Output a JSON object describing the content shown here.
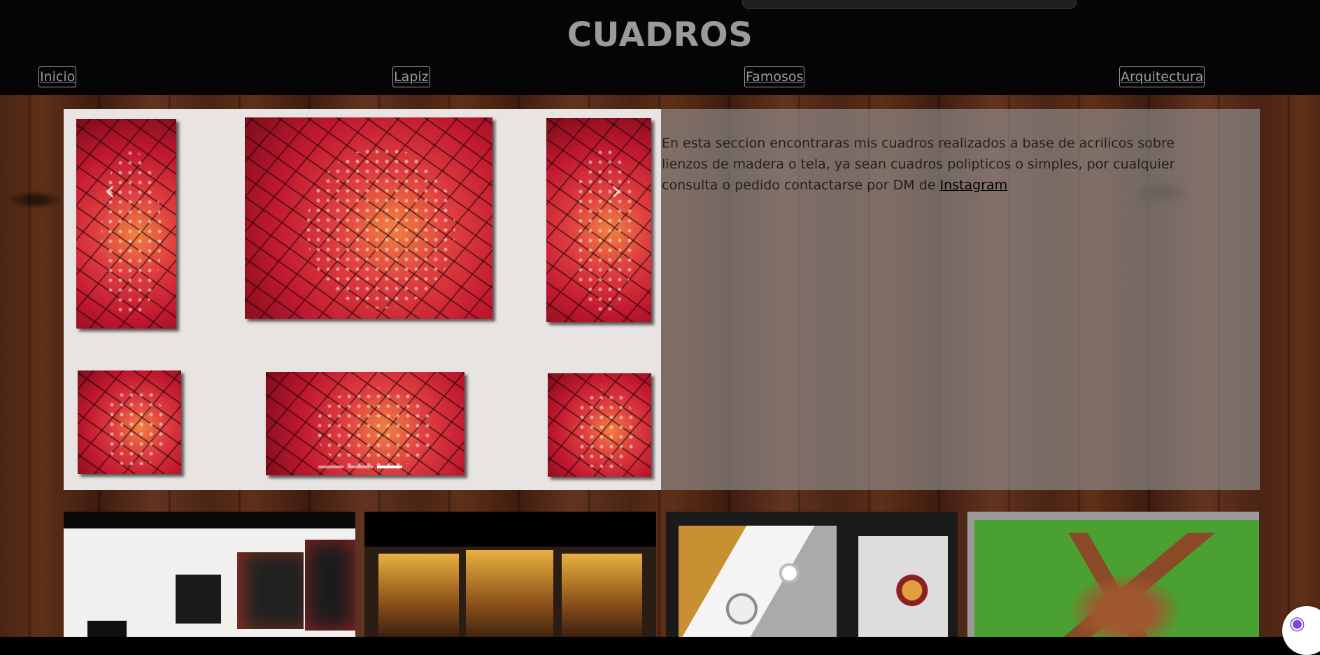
{
  "header": {
    "title": "CUADROS",
    "nav": [
      {
        "label": "Inicio"
      },
      {
        "label": "Lapiz"
      },
      {
        "label": "Famosos"
      },
      {
        "label": "Arquitectura"
      }
    ]
  },
  "hero": {
    "description": "En esta seccion encontraras mis cuadros realizados a base de acrilicos sobre lienzos de madera o tela, ya sean cuadros polipticos o simples, por cualquier consulta o pedido contactarse por DM de ",
    "link_label": "Instagram",
    "carousel": {
      "prev_icon": "chevron-left-icon",
      "next_icon": "chevron-right-icon",
      "prev_glyph": "‹",
      "next_glyph": "›",
      "slide_count": 3,
      "active_slide": 3
    }
  },
  "chat_widget": {
    "icon": "brain-icon",
    "glyph": "◉"
  },
  "colors": {
    "header_bg": "#050505",
    "title": "#9a9a9a",
    "panel_overlay": "rgba(150,150,150,0.62)"
  }
}
